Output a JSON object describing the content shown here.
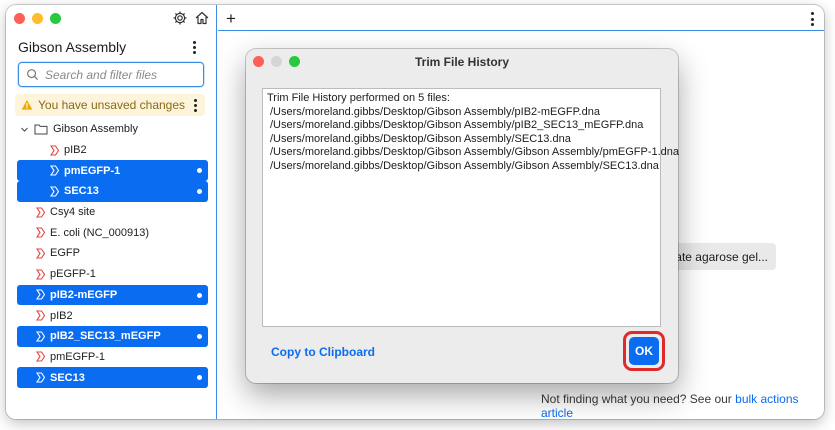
{
  "sidebar": {
    "title": "Gibson Assembly",
    "search_placeholder": "Search and filter files",
    "warning": "You have unsaved changes",
    "folder": "Gibson Assembly",
    "folder_items": [
      {
        "label": "pIB2",
        "selected": false
      },
      {
        "label": "pmEGFP-1",
        "selected": true
      },
      {
        "label": "SEC13",
        "selected": true
      }
    ],
    "items": [
      {
        "label": "Csy4 site",
        "selected": false
      },
      {
        "label": "E. coli (NC_000913)",
        "selected": false
      },
      {
        "label": "EGFP",
        "selected": false
      },
      {
        "label": "pEGFP-1",
        "selected": false
      },
      {
        "label": "pIB2-mEGFP",
        "selected": true
      },
      {
        "label": "pIB2",
        "selected": false
      },
      {
        "label": "pIB2_SEC13_mEGFP",
        "selected": true
      },
      {
        "label": "pmEGFP-1",
        "selected": false
      },
      {
        "label": "SEC13",
        "selected": true
      }
    ]
  },
  "main": {
    "new_tab": "+",
    "ghost_button": "ate agarose gel...",
    "footer_text": "Not finding what you need? See our",
    "footer_link": "bulk actions article"
  },
  "dialog": {
    "title": "Trim File History",
    "header": "Trim File History performed on 5 files:",
    "files": [
      "/Users/moreland.gibbs/Desktop/Gibson Assembly/pIB2-mEGFP.dna",
      "/Users/moreland.gibbs/Desktop/Gibson Assembly/pIB2_SEC13_mEGFP.dna",
      "/Users/moreland.gibbs/Desktop/Gibson Assembly/SEC13.dna",
      "/Users/moreland.gibbs/Desktop/Gibson Assembly/Gibson Assembly/pmEGFP-1.dna",
      "/Users/moreland.gibbs/Desktop/Gibson Assembly/Gibson Assembly/SEC13.dna"
    ],
    "copy_label": "Copy to Clipboard",
    "ok_label": "OK"
  },
  "colors": {
    "accent": "#0a6cf0",
    "highlight_ring": "#e0292a",
    "warning_bg": "#fdf4dc",
    "seq_icon": "#e0453f"
  },
  "icons": {
    "settings": "gear-icon",
    "home": "home-icon",
    "search": "search-icon",
    "warning": "warning-icon",
    "folder": "folder-icon",
    "sequence": "dna-sequence-icon"
  }
}
